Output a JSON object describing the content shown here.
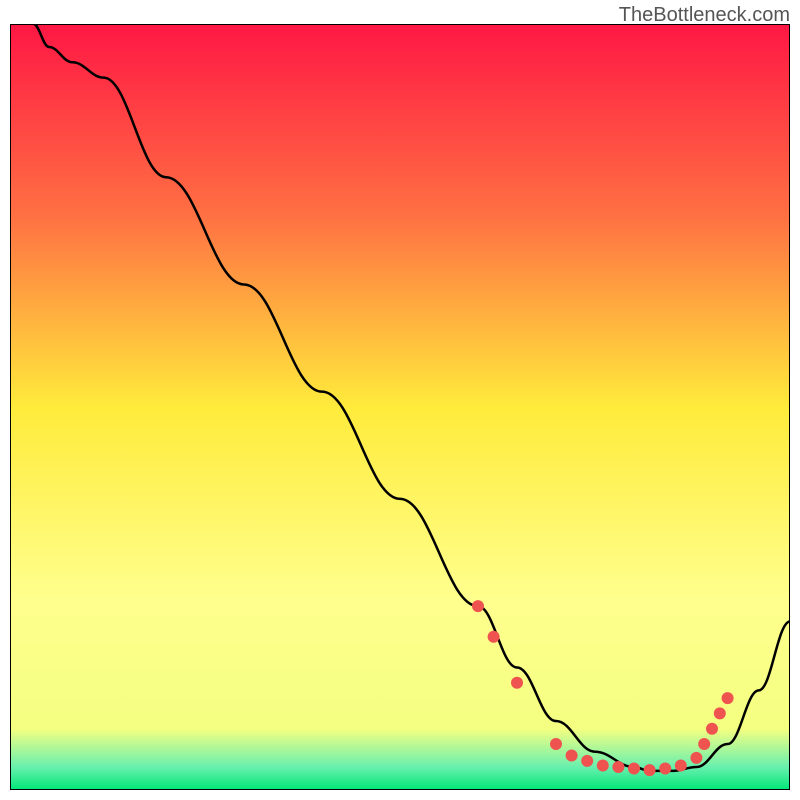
{
  "watermark": "TheBottleneck.com",
  "chart_data": {
    "type": "line",
    "title": "",
    "xlabel": "",
    "ylabel": "",
    "xlim": [
      0,
      100
    ],
    "ylim": [
      0,
      100
    ],
    "gradient_stops": [
      {
        "offset": 0,
        "color": "#ff1744"
      },
      {
        "offset": 25,
        "color": "#ff7043"
      },
      {
        "offset": 50,
        "color": "#ffeb3b"
      },
      {
        "offset": 75,
        "color": "#ffff8d"
      },
      {
        "offset": 92,
        "color": "#f4ff81"
      },
      {
        "offset": 97,
        "color": "#69f0ae"
      },
      {
        "offset": 100,
        "color": "#00e676"
      }
    ],
    "series": [
      {
        "name": "curve",
        "color": "#000000",
        "x": [
          3,
          5,
          8,
          12,
          20,
          30,
          40,
          50,
          60,
          65,
          70,
          75,
          80,
          82,
          85,
          88,
          92,
          96,
          100
        ],
        "y": [
          100,
          97,
          95,
          93,
          80,
          66,
          52,
          38,
          24,
          16,
          9,
          5,
          3,
          2.5,
          2.5,
          3,
          6,
          13,
          22
        ]
      }
    ],
    "markers": {
      "name": "highlight-dots",
      "color": "#ef5350",
      "radius": 6,
      "points": [
        {
          "x": 60,
          "y": 24
        },
        {
          "x": 62,
          "y": 20
        },
        {
          "x": 65,
          "y": 14
        },
        {
          "x": 70,
          "y": 6
        },
        {
          "x": 72,
          "y": 4.5
        },
        {
          "x": 74,
          "y": 3.8
        },
        {
          "x": 76,
          "y": 3.2
        },
        {
          "x": 78,
          "y": 3
        },
        {
          "x": 80,
          "y": 2.8
        },
        {
          "x": 82,
          "y": 2.6
        },
        {
          "x": 84,
          "y": 2.8
        },
        {
          "x": 86,
          "y": 3.2
        },
        {
          "x": 88,
          "y": 4.2
        },
        {
          "x": 89,
          "y": 6
        },
        {
          "x": 90,
          "y": 8
        },
        {
          "x": 91,
          "y": 10
        },
        {
          "x": 92,
          "y": 12
        }
      ]
    }
  }
}
